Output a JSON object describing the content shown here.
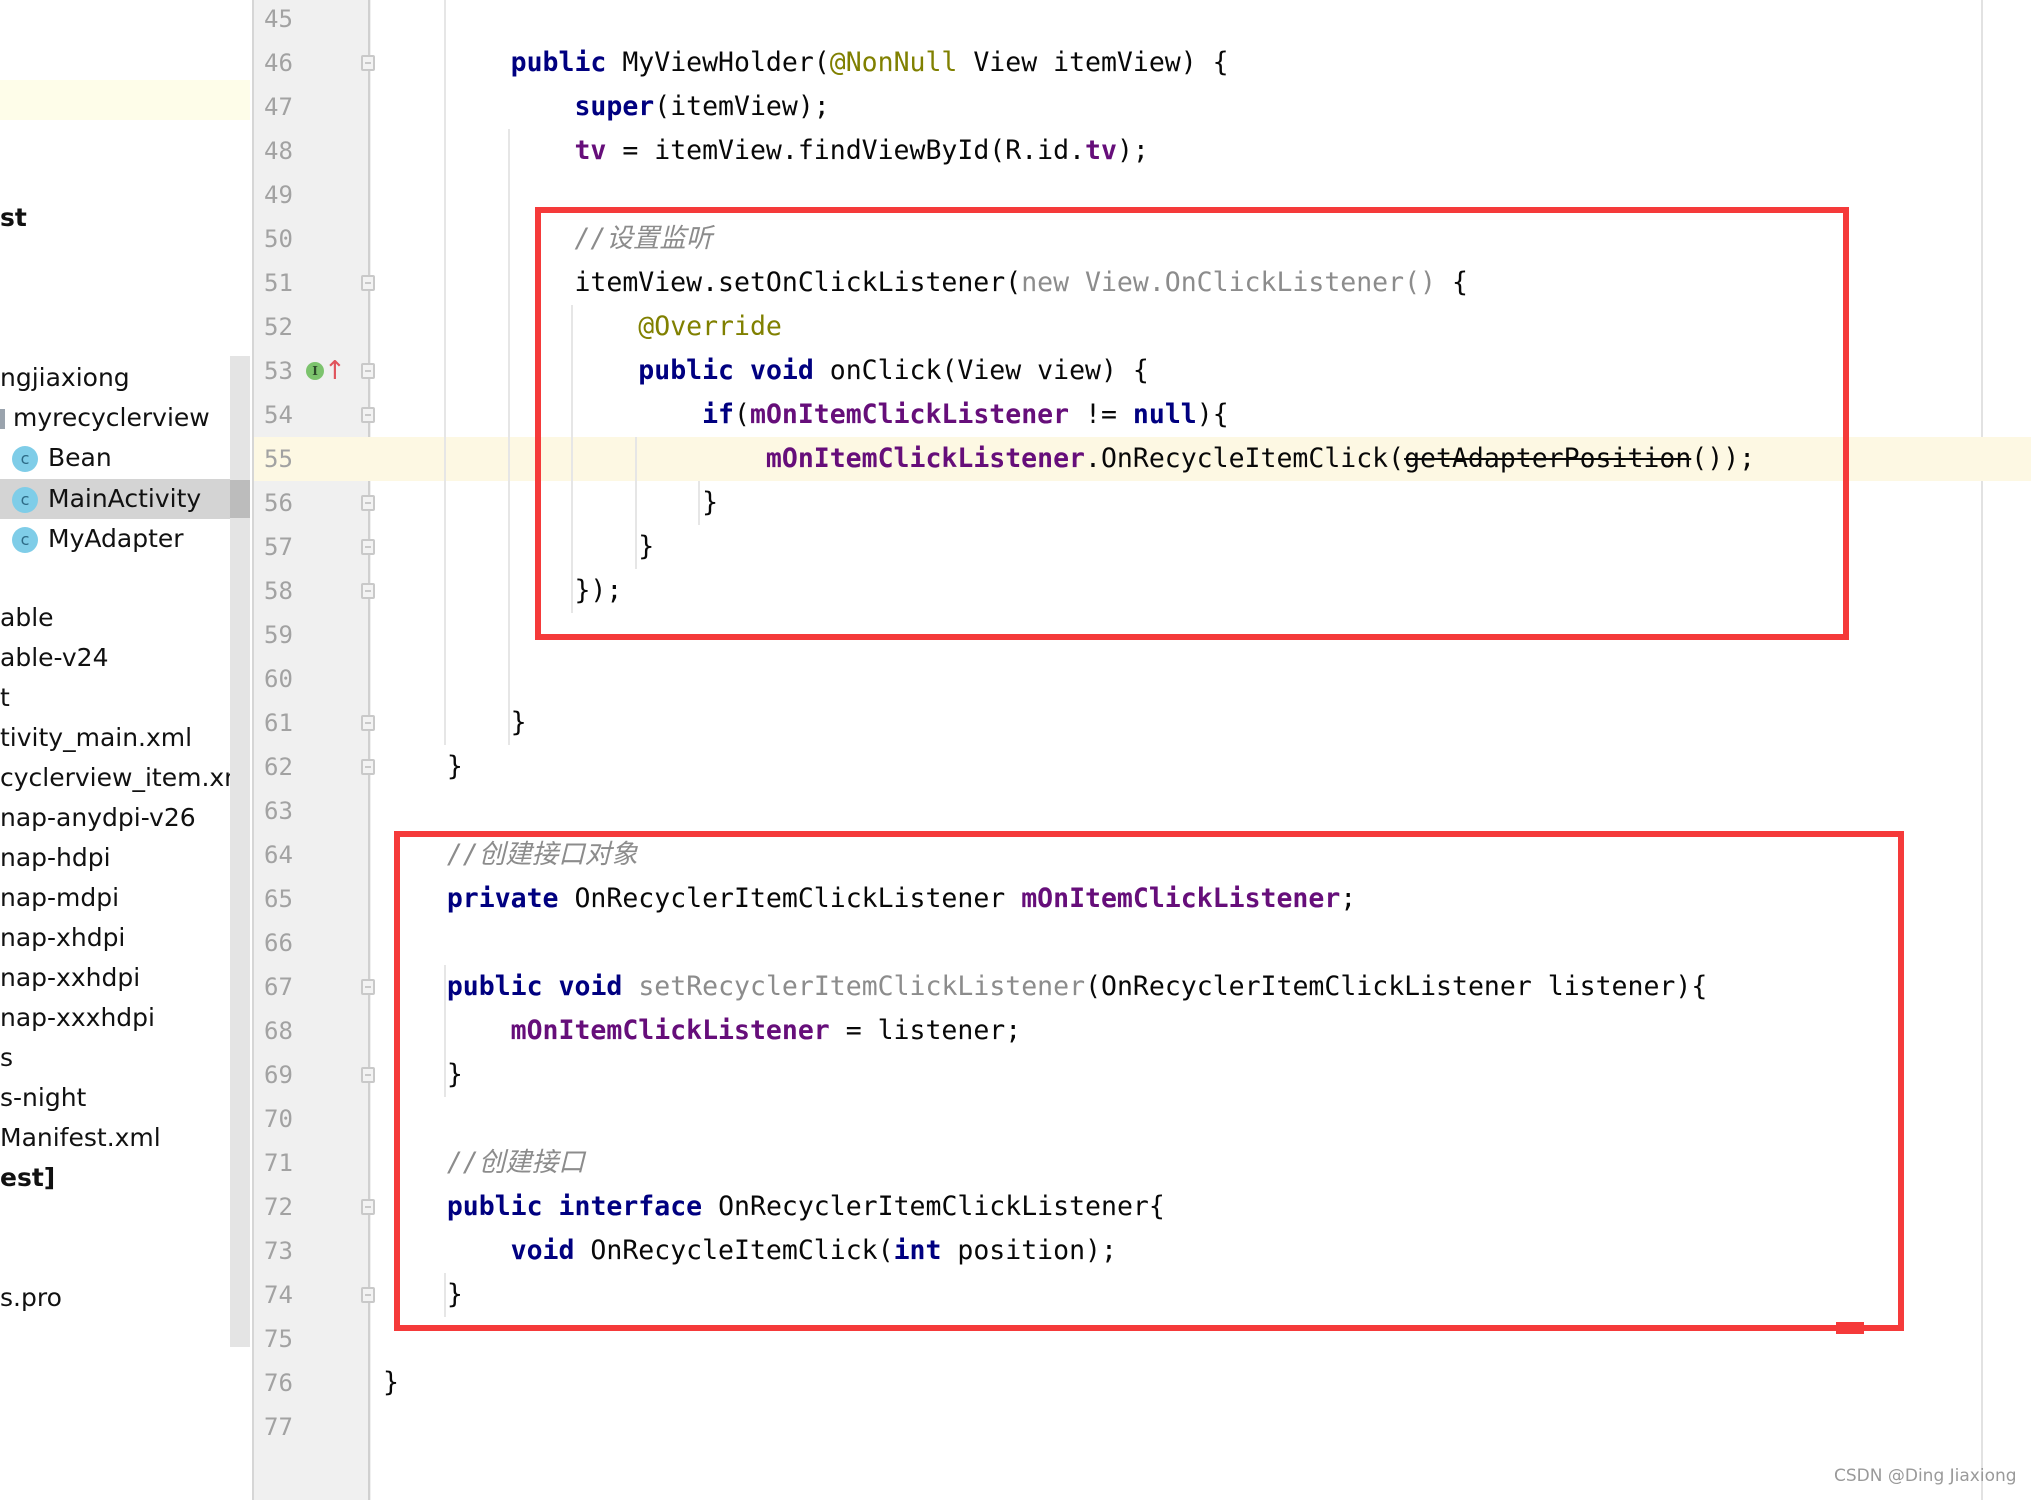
{
  "sidebar": {
    "items": [
      {
        "label": "st",
        "bold": true
      },
      {
        "label": "ngjiaxiong"
      },
      {
        "label": "myrecyclerview",
        "icon": "folder-icon"
      },
      {
        "label": "Bean",
        "icon": "class-icon"
      },
      {
        "label": "MainActivity",
        "icon": "class-icon",
        "selected": true
      },
      {
        "label": "MyAdapter",
        "icon": "class-icon"
      },
      {
        "label": "able"
      },
      {
        "label": "able-v24"
      },
      {
        "label": "t"
      },
      {
        "label": "tivity_main.xml"
      },
      {
        "label": "cyclerview_item.xml"
      },
      {
        "label": "nap-anydpi-v26"
      },
      {
        "label": "nap-hdpi"
      },
      {
        "label": "nap-mdpi"
      },
      {
        "label": "nap-xhdpi"
      },
      {
        "label": "nap-xxhdpi"
      },
      {
        "label": "nap-xxxhdpi"
      },
      {
        "label": "s"
      },
      {
        "label": "s-night"
      },
      {
        "label": "Manifest.xml"
      },
      {
        "label": "est]",
        "bold": true
      },
      {
        "label": "s.pro"
      }
    ],
    "class_icon_letter": "c"
  },
  "editor": {
    "current_line": 55,
    "implement_icon_letter": "I",
    "override_arrow": "↑",
    "lines": [
      {
        "n": "45",
        "t": []
      },
      {
        "n": "46",
        "t": [
          [
            "        "
          ],
          [
            "public",
            "kw"
          ],
          [
            " MyViewHolder("
          ],
          [
            "@NonNull",
            "ann"
          ],
          [
            " View itemView) {"
          ]
        ]
      },
      {
        "n": "47",
        "t": [
          [
            "            "
          ],
          [
            "super",
            "kw"
          ],
          [
            "(itemView);"
          ]
        ]
      },
      {
        "n": "48",
        "t": [
          [
            "            "
          ],
          [
            "tv",
            "fld"
          ],
          [
            " = itemView.findViewById(R.id."
          ],
          [
            "tv",
            "fld"
          ],
          [
            ");"
          ]
        ]
      },
      {
        "n": "49",
        "t": []
      },
      {
        "n": "50",
        "t": [
          [
            "            "
          ],
          [
            "//设置监听",
            "cmt"
          ]
        ]
      },
      {
        "n": "51",
        "t": [
          [
            "            itemView.setOnClickListener("
          ],
          [
            "new View.OnClickListener()",
            "gray"
          ],
          [
            " {"
          ]
        ]
      },
      {
        "n": "52",
        "t": [
          [
            "                "
          ],
          [
            "@Override",
            "ann"
          ]
        ]
      },
      {
        "n": "53",
        "t": [
          [
            "                "
          ],
          [
            "public",
            "kw"
          ],
          [
            " "
          ],
          [
            "void",
            "kw"
          ],
          [
            " onClick(View view) {"
          ]
        ]
      },
      {
        "n": "54",
        "t": [
          [
            "                    "
          ],
          [
            "if",
            "kw"
          ],
          [
            "("
          ],
          [
            "mOnItemClickListener",
            "fld"
          ],
          [
            " != "
          ],
          [
            "null",
            "kw"
          ],
          [
            "){"
          ]
        ]
      },
      {
        "n": "55",
        "t": [
          [
            "                        "
          ],
          [
            "mOnItemClickListener",
            "fld"
          ],
          [
            ".OnRecycleItemClick("
          ],
          [
            "getAdapterPosition",
            "strike"
          ],
          [
            "());"
          ]
        ]
      },
      {
        "n": "56",
        "t": [
          [
            "                    }"
          ]
        ]
      },
      {
        "n": "57",
        "t": [
          [
            "                }"
          ]
        ]
      },
      {
        "n": "58",
        "t": [
          [
            "            });"
          ]
        ]
      },
      {
        "n": "59",
        "t": []
      },
      {
        "n": "60",
        "t": []
      },
      {
        "n": "61",
        "t": [
          [
            "        }"
          ]
        ]
      },
      {
        "n": "62",
        "t": [
          [
            "    }"
          ]
        ]
      },
      {
        "n": "63",
        "t": []
      },
      {
        "n": "64",
        "t": [
          [
            "    "
          ],
          [
            "//创建接口对象",
            "cmt"
          ]
        ]
      },
      {
        "n": "65",
        "t": [
          [
            "    "
          ],
          [
            "private",
            "kw"
          ],
          [
            " OnRecyclerItemClickListener "
          ],
          [
            "mOnItemClickListener",
            "fld"
          ],
          [
            ";"
          ]
        ]
      },
      {
        "n": "66",
        "t": []
      },
      {
        "n": "67",
        "t": [
          [
            "    "
          ],
          [
            "public",
            "kw"
          ],
          [
            " "
          ],
          [
            "void",
            "kw"
          ],
          [
            " "
          ],
          [
            "setRecyclerItemClickListener",
            "gray"
          ],
          [
            "(OnRecyclerItemClickListener listener){"
          ]
        ]
      },
      {
        "n": "68",
        "t": [
          [
            "        "
          ],
          [
            "mOnItemClickListener",
            "fld"
          ],
          [
            " = listener;"
          ]
        ]
      },
      {
        "n": "69",
        "t": [
          [
            "    }"
          ]
        ]
      },
      {
        "n": "70",
        "t": []
      },
      {
        "n": "71",
        "t": [
          [
            "    "
          ],
          [
            "//创建接口",
            "cmt"
          ]
        ]
      },
      {
        "n": "72",
        "t": [
          [
            "    "
          ],
          [
            "public",
            "kw"
          ],
          [
            " "
          ],
          [
            "interface",
            "kw"
          ],
          [
            " OnRecyclerItemClickListener{"
          ]
        ]
      },
      {
        "n": "73",
        "t": [
          [
            "        "
          ],
          [
            "void",
            "kw"
          ],
          [
            " OnRecycleItemClick("
          ],
          [
            "int",
            "kw"
          ],
          [
            " position);"
          ]
        ]
      },
      {
        "n": "74",
        "t": [
          [
            "    }"
          ]
        ]
      },
      {
        "n": "75",
        "t": []
      },
      {
        "n": "76",
        "t": [
          [
            "}"
          ]
        ]
      },
      {
        "n": "77",
        "t": []
      }
    ],
    "fold_lines": [
      "46",
      "51",
      "53",
      "54",
      "56",
      "57",
      "58",
      "61",
      "62",
      "67",
      "69",
      "72",
      "74"
    ]
  },
  "annotation_color": "#f53a3a",
  "watermark": "CSDN @Ding Jiaxiong"
}
